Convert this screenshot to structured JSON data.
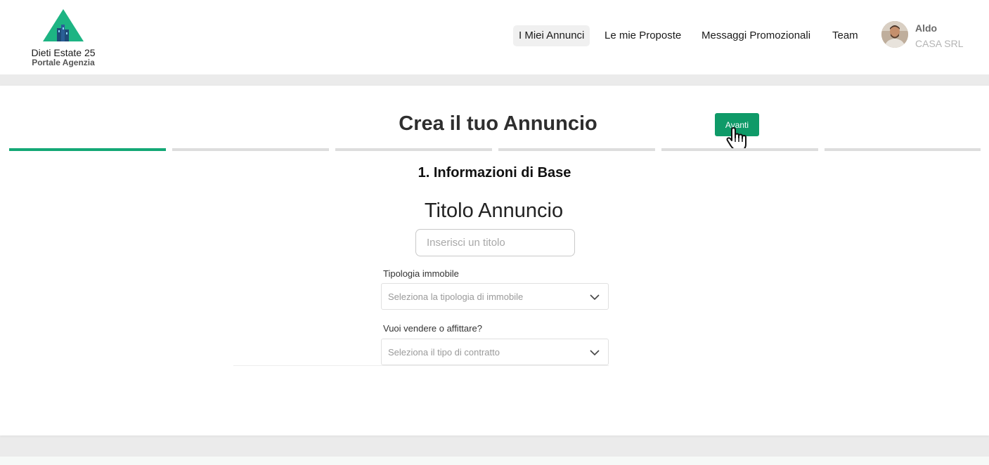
{
  "brand": {
    "name": "Dieti Estate 25",
    "subtitle": "Portale Agenzia",
    "color": "#1db483"
  },
  "nav": {
    "items": [
      {
        "label": "I Miei Annunci",
        "active": true
      },
      {
        "label": "Le mie Proposte"
      },
      {
        "label": "Messaggi Promozionali"
      },
      {
        "label": "Team"
      }
    ]
  },
  "user": {
    "name": "Aldo",
    "company": "CASA SRL"
  },
  "wizard": {
    "title": "Crea il tuo Annuncio",
    "next_label": "Avanti",
    "steps_total": 6,
    "current_step": 1,
    "section_title": "1. Informazioni di Base",
    "accent_color": "#0f9a68"
  },
  "form": {
    "title_label": "Titolo Annuncio",
    "title_placeholder": "Inserisci un titolo",
    "title_value": "",
    "property_type_label": "Tipologia immobile",
    "property_type_placeholder": "Seleziona la tipologia di immobile",
    "contract_label": "Vuoi vendere o affittare?",
    "contract_placeholder": "Seleziona il tipo di contratto"
  },
  "icons": {
    "logo": "house-triangle-logo",
    "cursor": "hand-pointer-icon",
    "dropdown": "chevron-down-icon"
  }
}
